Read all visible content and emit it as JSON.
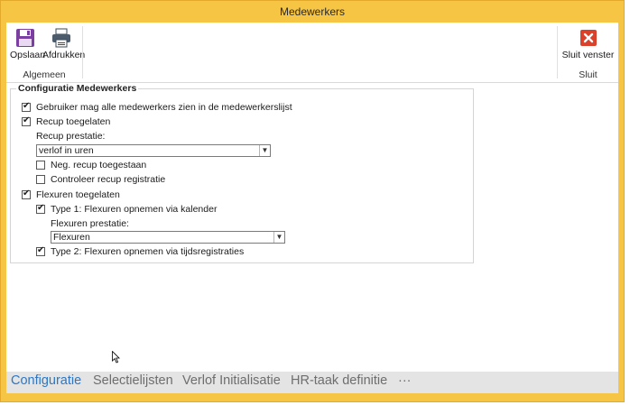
{
  "window": {
    "title": "Medewerkers"
  },
  "ribbon": {
    "groups": [
      {
        "label": "Algemeen",
        "buttons": [
          {
            "label": "Opslaan",
            "icon": "floppy-disk-icon"
          },
          {
            "label": "Afdrukken",
            "icon": "printer-icon"
          }
        ]
      },
      {
        "label": "Sluit",
        "buttons": [
          {
            "label": "Sluit venster",
            "icon": "close-window-icon"
          }
        ]
      }
    ]
  },
  "config": {
    "legend": "Configuratie Medewerkers",
    "see_all": {
      "label": "Gebruiker mag alle medewerkers zien in de medewerkerslijst",
      "checked": true
    },
    "recup": {
      "label": "Recup toegelaten",
      "checked": true
    },
    "recup_prestatie": {
      "label": "Recup prestatie:",
      "value": "verlof in uren"
    },
    "neg_recup": {
      "label": "Neg. recup toegestaan",
      "checked": false
    },
    "controleer_recup": {
      "label": "Controleer recup registratie",
      "checked": false
    },
    "flexuren": {
      "label": "Flexuren toegelaten",
      "checked": true
    },
    "type1": {
      "label": "Type 1: Flexuren opnemen via kalender",
      "checked": true
    },
    "flexuren_prestatie": {
      "label": "Flexuren prestatie:",
      "value": "Flexuren"
    },
    "type2": {
      "label": "Type 2: Flexuren opnemen via tijdsregistraties",
      "checked": true
    }
  },
  "tabs": [
    {
      "label": "Configuratie",
      "active": true
    },
    {
      "label": "Selectielijsten",
      "active": false
    },
    {
      "label": "Verlof Initialisatie",
      "active": false
    },
    {
      "label": "HR-taak definitie",
      "active": false
    },
    {
      "label": "···",
      "active": false
    }
  ],
  "colors": {
    "window_frame": "#f6c544",
    "accent_tab": "#2d77c4",
    "close_icon": "#d9412b",
    "floppy_icon": "#7a3fa0"
  }
}
